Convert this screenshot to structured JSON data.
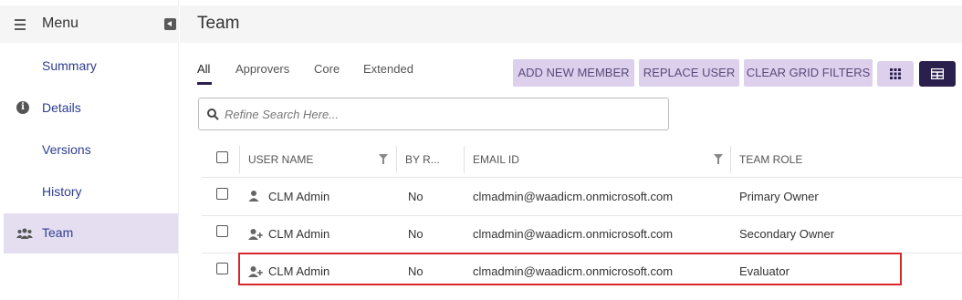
{
  "sidebar": {
    "title": "Menu",
    "items": [
      {
        "label": "Summary",
        "active": false
      },
      {
        "label": "Details",
        "active": false,
        "icon": "info-icon"
      },
      {
        "label": "Versions",
        "active": false
      },
      {
        "label": "History",
        "active": false
      },
      {
        "label": "Team",
        "active": true,
        "icon": "team-icon"
      }
    ]
  },
  "header": {
    "title": "Team"
  },
  "tabs": [
    "All",
    "Approvers",
    "Core",
    "Extended"
  ],
  "toolbar": {
    "add_new_member": "ADD NEW MEMBER",
    "replace_user": "REPLACE USER",
    "clear_grid_filters": "CLEAR GRID FILTERS",
    "grid_view_icon": "grid-view-icon",
    "table_view_icon": "table-view-icon"
  },
  "search": {
    "placeholder": "Refine Search Here..."
  },
  "grid": {
    "columns": [
      "USER NAME",
      "BY R...",
      "EMAIL ID",
      "TEAM ROLE"
    ],
    "rows": [
      {
        "user_name": "CLM Admin",
        "by_role": "No",
        "email": "clmadmin@waadicm.onmicrosoft.com",
        "team_role": "Primary Owner",
        "icon": "user-icon"
      },
      {
        "user_name": "CLM Admin",
        "by_role": "No",
        "email": "clmadmin@waadicm.onmicrosoft.com",
        "team_role": "Secondary Owner",
        "icon": "user-add-icon"
      },
      {
        "user_name": "CLM Admin",
        "by_role": "No",
        "email": "clmadmin@waadicm.onmicrosoft.com",
        "team_role": "Evaluator",
        "icon": "user-add-icon",
        "highlighted": true
      }
    ]
  },
  "colors": {
    "accent": "#2b1f4e",
    "button_bg": "#dcd0ed",
    "active_nav": "#e5def0",
    "highlight_border": "#d9262b"
  }
}
